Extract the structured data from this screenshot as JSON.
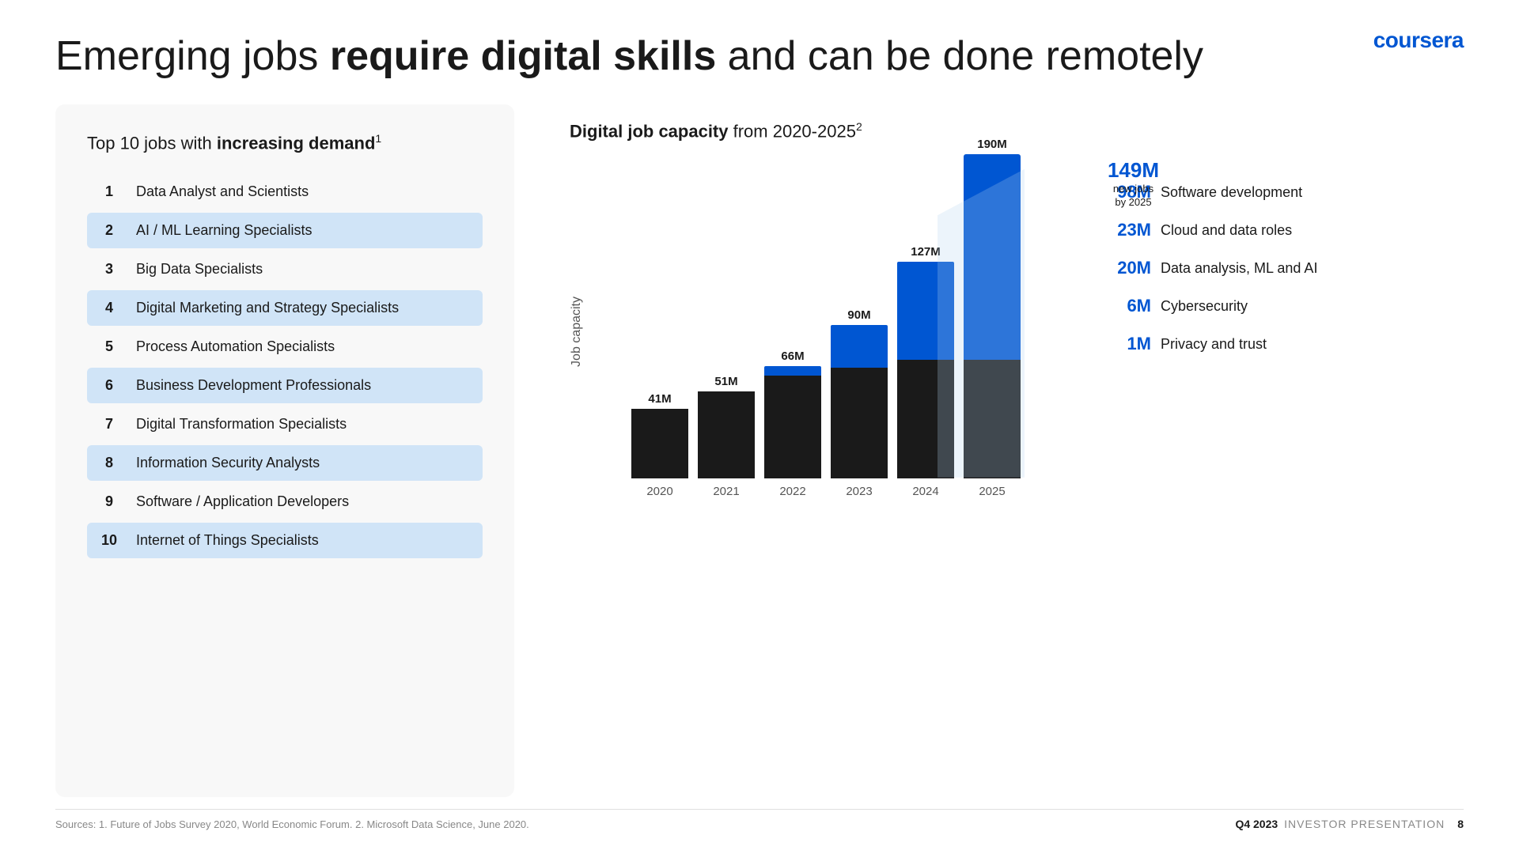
{
  "logo": "coursera",
  "title": {
    "prefix": "Emerging jobs ",
    "bold": "require digital skills",
    "suffix": " and can be done remotely"
  },
  "left": {
    "title_normal": "Top 10 jobs with ",
    "title_bold": "increasing demand",
    "title_sup": "1",
    "jobs": [
      {
        "number": "1",
        "name": "Data Analyst and Scientists",
        "highlighted": false
      },
      {
        "number": "2",
        "name": "AI / ML  Learning Specialists",
        "highlighted": true
      },
      {
        "number": "3",
        "name": "Big Data Specialists",
        "highlighted": false
      },
      {
        "number": "4",
        "name": "Digital Marketing and Strategy Specialists",
        "highlighted": true
      },
      {
        "number": "5",
        "name": "Process Automation Specialists",
        "highlighted": false
      },
      {
        "number": "6",
        "name": "Business Development Professionals",
        "highlighted": true
      },
      {
        "number": "7",
        "name": "Digital Transformation Specialists",
        "highlighted": false
      },
      {
        "number": "8",
        "name": "Information Security Analysts",
        "highlighted": true
      },
      {
        "number": "9",
        "name": "Software / Application Developers",
        "highlighted": false
      },
      {
        "number": "10",
        "name": "Internet of Things Specialists",
        "highlighted": true
      }
    ]
  },
  "right": {
    "title_normal": "Digital job capacity",
    "title_suffix": " from 2020-2025",
    "title_sup": "2",
    "y_axis_label": "Job capacity",
    "annotation": {
      "value": "149M",
      "line1": "new jobs",
      "line2": "by 2025"
    },
    "bars": [
      {
        "year": "2020",
        "total_label": "41M",
        "blue_height": 30,
        "dark_height": 110
      },
      {
        "year": "2021",
        "total_label": "51M",
        "blue_height": 40,
        "dark_height": 120
      },
      {
        "year": "2022",
        "total_label": "66M",
        "blue_height": 60,
        "dark_height": 130
      },
      {
        "year": "2023",
        "total_label": "90M",
        "blue_height": 90,
        "dark_height": 140
      },
      {
        "year": "2024",
        "total_label": "127M",
        "blue_height": 155,
        "dark_height": 150
      },
      {
        "year": "2025",
        "total_label": "190M",
        "blue_height": 260,
        "dark_height": 150
      }
    ],
    "legend": [
      {
        "value": "98M",
        "text": "Software development"
      },
      {
        "value": "23M",
        "text": "Cloud and data roles"
      },
      {
        "value": "20M",
        "text": "Data analysis, ML and AI"
      },
      {
        "value": "6M",
        "text": "Cybersecurity"
      },
      {
        "value": "1M",
        "text": "Privacy and trust"
      }
    ]
  },
  "footer": {
    "sources": "Sources: 1. Future of Jobs Survey 2020, World Economic Forum. 2. Microsoft Data Science, June 2020.",
    "quarter": "Q4 2023",
    "presentation": "INVESTOR PRESENTATION",
    "page": "8"
  }
}
